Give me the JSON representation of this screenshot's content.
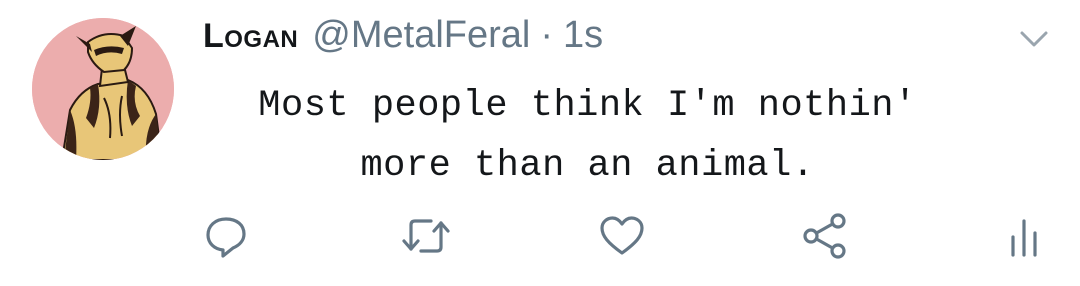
{
  "tweet": {
    "display_name": "Logan",
    "handle": "@MetalFeral",
    "separator": "·",
    "time": "1s",
    "text_lines": [
      "Most people think I'm nothin'",
      "more than an animal."
    ]
  },
  "icons": {
    "avatar": "avatar-wolverine",
    "caret": "chevron-down-icon",
    "reply": "reply-icon",
    "retweet": "retweet-icon",
    "like": "heart-icon",
    "share": "share-icon",
    "analytics": "analytics-icon"
  },
  "colors": {
    "text": "#14171a",
    "secondary": "#657786",
    "icon": "#657786",
    "avatar_bg": "#ecadad"
  }
}
